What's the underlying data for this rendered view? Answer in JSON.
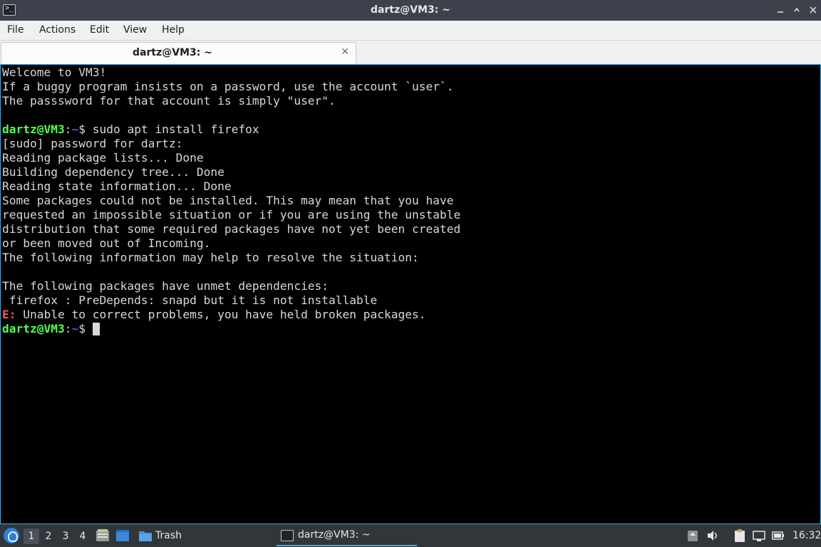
{
  "window": {
    "title": "dartz@VM3: ~",
    "controls": {
      "minimize": "_",
      "maximize": "□",
      "close": "✕"
    }
  },
  "menu": [
    "File",
    "Actions",
    "Edit",
    "View",
    "Help"
  ],
  "tab": {
    "label": "dartz@VM3: ~",
    "close": "✕"
  },
  "terminal": {
    "prompt_user": "dartz@VM3",
    "prompt_colon": ":",
    "prompt_path": "~",
    "prompt_symbol": "$ ",
    "welcome": [
      "Welcome to VM3!",
      "If a buggy program insists on a password, use the account `user`.",
      "The passsword for that account is simply \"user\"."
    ],
    "command": "sudo apt install firefox",
    "output": [
      "[sudo] password for dartz:",
      "Reading package lists... Done",
      "Building dependency tree... Done",
      "Reading state information... Done",
      "Some packages could not be installed. This may mean that you have",
      "requested an impossible situation or if you are using the unstable",
      "distribution that some required packages have not yet been created",
      "or been moved out of Incoming.",
      "The following information may help to resolve the situation:",
      "",
      "The following packages have unmet dependencies:",
      " firefox : PreDepends: snapd but it is not installable"
    ],
    "error_prefix": "E:",
    "error_text": " Unable to correct problems, you have held broken packages."
  },
  "taskbar": {
    "workspaces": [
      "1",
      "2",
      "3",
      "4"
    ],
    "active_workspace": "1",
    "launcher_label": "Trash",
    "task_label": "dartz@VM3: ~",
    "clock": "16:32",
    "icons": [
      "start-menu-icon",
      "file-manager-icon",
      "show-desktop-icon",
      "trash-folder-icon",
      "terminal-icon",
      "upload-icon",
      "volume-icon",
      "clipboard-icon",
      "network-icon",
      "battery-icon"
    ]
  },
  "colors": {
    "accent": "#3daee9",
    "prompt_user": "#54ff54",
    "prompt_path": "#5454ff",
    "error": "#ff5454",
    "terminal_bg": "#000000",
    "terminal_fg": "#d8d8d8"
  }
}
